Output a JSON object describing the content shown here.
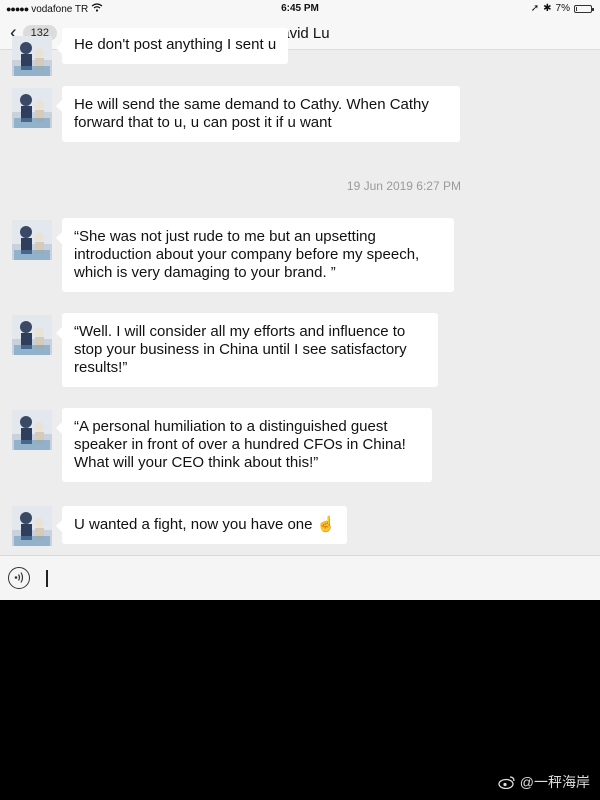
{
  "status_bar": {
    "signal": "●●●●●",
    "carrier": "vodafone TR",
    "wifi_icon": "wifi-icon",
    "time": "6:45 PM",
    "location_icon": "➚",
    "bluetooth_icon": "✱",
    "battery_percent": "7%",
    "battery_level": 0.07
  },
  "nav": {
    "back_chevron": "‹",
    "unread_count": "132",
    "contact_name": "David Lu"
  },
  "messages": [
    {
      "text": "He don't post anything I sent u"
    },
    {
      "text": "He will send the same demand to Cathy. When Cathy forward that to u, u can post it if u want"
    },
    {
      "text": "“She was not just rude to me but an upsetting introduction about your company before my speech, which is very damaging to your brand. ”"
    },
    {
      "text": "“Well. I will consider all my efforts and influence to stop your business in China until I see satisfactory results!”"
    },
    {
      "text": "“A personal humiliation to a distinguished guest speaker in front of over a hundred CFOs in China! What will your CEO think about this!”"
    },
    {
      "text": "U wanted a fight, now you have one ☝️"
    }
  ],
  "timestamp": "19 Jun 2019 6:27 PM",
  "input": {
    "voice_icon": "🔊",
    "value": ""
  },
  "watermark": {
    "text": "@一秤海岸"
  }
}
